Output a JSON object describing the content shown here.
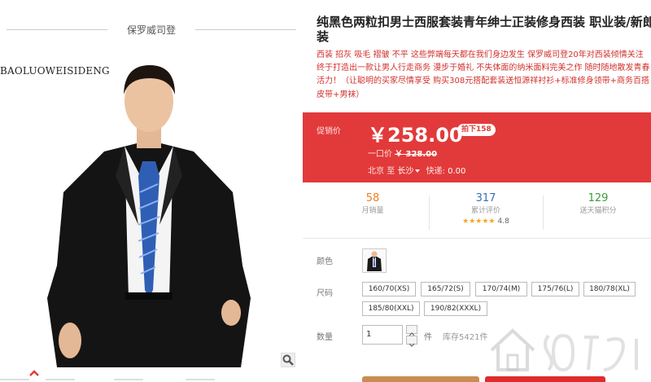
{
  "gallery": {
    "brand_name": "保罗威司登",
    "brand_latin": "BAOLUOWEISIDENG"
  },
  "product": {
    "title": "纯黑色两粒扣男士西服套装青年绅士正装修身西装 职业装/新郎装",
    "subtitle": "西装 招灰 吸毛 褶皱 不平 这些弊端每天都在我们身边发生 保罗威司登20年对西装倾情关注 终于打造出一款让男人行走商务 漫步于婚礼 不失体面的纳米面料完美之作 随时随地散发青春活力！（让聪明的买家尽情享受 购买308元搭配套装送恒源祥衬衫+标准修身领带+商务百搭皮带+男袜）"
  },
  "price": {
    "label": "促销价",
    "current": "￥258.00",
    "badge": "拍下158",
    "original_label": "一口价",
    "original_value": "￥ 328.00",
    "ship_from": "北京",
    "ship_to_word": "至",
    "ship_city": "长沙",
    "ship_fee_label": "快递:",
    "ship_fee": "0.00"
  },
  "stats": {
    "monthly_sales": "58",
    "monthly_sales_label": "月销量",
    "reviews": "317",
    "reviews_label": "累计评价",
    "rating_stars": "★★★★★",
    "rating_value": "4.8",
    "points": "129",
    "points_label": "送天猫积分"
  },
  "options": {
    "color_label": "颜色",
    "size_label": "尺码",
    "sizes": [
      "160/70(XS)",
      "165/72(S)",
      "170/74(M)",
      "175/76(L)",
      "180/78(XL)",
      "185/80(XXL)",
      "190/82(XXXL)"
    ],
    "qty_label": "数量",
    "qty_value": "1",
    "qty_unit": "件",
    "stock": "库存5421件"
  },
  "colors": {
    "accent_red": "#e23a3a",
    "cart_brown": "#c98d53",
    "buy_red": "#e02c2c",
    "sales_orange": "#f0801f",
    "reviews_blue": "#3a6fb0",
    "points_green": "#3a9a3a"
  },
  "icons": {
    "zoom": "magnifier-icon",
    "thumb_up": "chevron-up-icon",
    "qty_up": "arrow-up-icon",
    "qty_down": "arrow-down-icon",
    "watermark": "house-logo-icon"
  }
}
